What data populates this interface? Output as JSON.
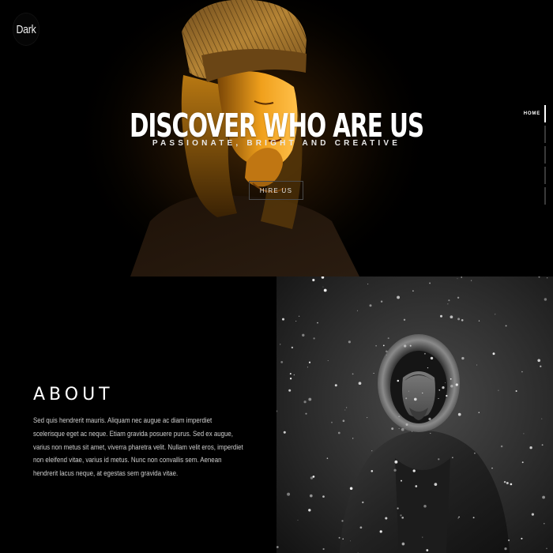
{
  "brand": {
    "logo_text": "Dark"
  },
  "hero": {
    "title": "DISCOVER WHO ARE US",
    "subtitle": "PASSIONATE, BRIGHT AND CREATIVE",
    "button_label": "HIRE US"
  },
  "nav": {
    "active_label": "HOME",
    "items": 5,
    "active_index": 0
  },
  "about": {
    "heading": "ABOUT",
    "body": "Sed quis hendrerit mauris. Aliquam nec augue ac diam imperdiet scelerisque eget ac neque. Etiam gravida posuere purus. Sed ex augue, varius non metus sit amet, viverra pharetra velit. Nullam velit eros, imperdiet non eleifend vitae, varius id metus. Nunc non convallis sem. Aenean hendrerit lacus neque, at egestas sem gravida vitae."
  },
  "colors": {
    "background": "#000000",
    "accent_warm": "#e8a020",
    "text": "#ffffff",
    "muted_text": "#cfcfcf"
  },
  "icons": {
    "hero_photo": "portrait-woman-beanie-photo",
    "about_photo": "man-in-snow-parka-photo"
  }
}
